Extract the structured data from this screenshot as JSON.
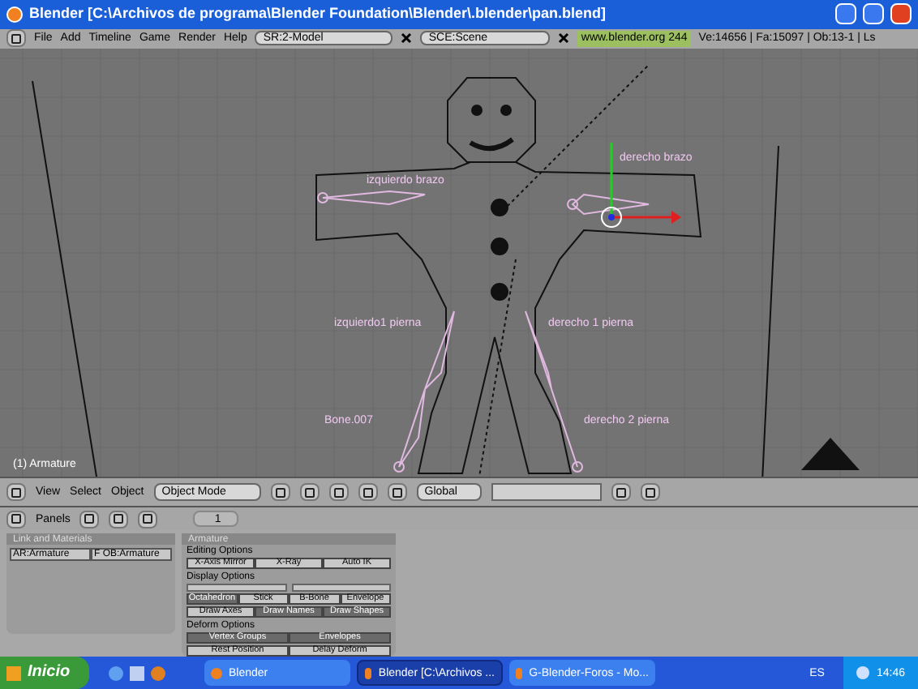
{
  "window": {
    "title": "Blender [C:\\Archivos de programa\\Blender Foundation\\Blender\\.blender\\pan.blend]"
  },
  "info_header": {
    "menus": [
      "File",
      "Add",
      "Timeline",
      "Game",
      "Render",
      "Help"
    ],
    "screen": "SR:2-Model",
    "scene": "SCE:Scene",
    "version": "www.blender.org 244",
    "stats": "Ve:14656 | Fa:15097 | Ob:13-1 | Ls"
  },
  "viewport": {
    "object_label": "(1) Armature",
    "bone_labels": [
      {
        "text": "izquierdo brazo"
      },
      {
        "text": "derecho brazo"
      },
      {
        "text": "izquierdo1 pierna"
      },
      {
        "text": "derecho 1 pierna"
      },
      {
        "text": "Bone.007"
      },
      {
        "text": "derecho 2 pierna"
      }
    ]
  },
  "view3d_header": {
    "menus": [
      "View",
      "Select",
      "Object"
    ],
    "mode": "Object Mode",
    "orientation": "Global"
  },
  "buttons_header": {
    "label": "Panels",
    "frame": "1"
  },
  "link_panel": {
    "title": "Link and Materials",
    "fields": [
      {
        "value": "AR:Armature"
      },
      {
        "prefix": "F",
        "value": "OB:Armature"
      }
    ]
  },
  "armature_panel": {
    "title": "Armature",
    "sections": [
      {
        "title": "Editing Options",
        "rows": [
          {
            "buttons": [
              {
                "label": "X-Axis Mirror",
                "selected": false
              },
              {
                "label": "X-Ray",
                "selected": false
              },
              {
                "label": "Auto IK",
                "selected": false
              }
            ]
          }
        ]
      },
      {
        "title": "Display Options",
        "rows": [
          {
            "buttons": [
              {
                "label": "Octahedron",
                "selected": true
              },
              {
                "label": "Stick",
                "selected": false
              },
              {
                "label": "B-Bone",
                "selected": false
              },
              {
                "label": "Envelope",
                "selected": false
              }
            ]
          },
          {
            "buttons": [
              {
                "label": "Draw Axes",
                "selected": false
              },
              {
                "label": "Draw Names",
                "selected": true
              },
              {
                "label": "Draw Shapes",
                "selected": true
              }
            ]
          }
        ]
      },
      {
        "title": "Deform Options",
        "rows": [
          {
            "buttons": [
              {
                "label": "Vertex Groups",
                "selected": true
              },
              {
                "label": "Envelopes",
                "selected": true
              }
            ]
          },
          {
            "buttons": [
              {
                "label": "Rest Position",
                "selected": false
              },
              {
                "label": "Delay Deform",
                "selected": false
              }
            ]
          }
        ]
      }
    ]
  },
  "taskbar": {
    "start": "Inicio",
    "tasks": [
      {
        "label": "Blender",
        "selected": false
      },
      {
        "label": "Blender [C:\\Archivos ...",
        "selected": true
      },
      {
        "label": "G-Blender-Foros - Mo...",
        "selected": false
      }
    ],
    "language": "ES",
    "time": "14:46"
  }
}
